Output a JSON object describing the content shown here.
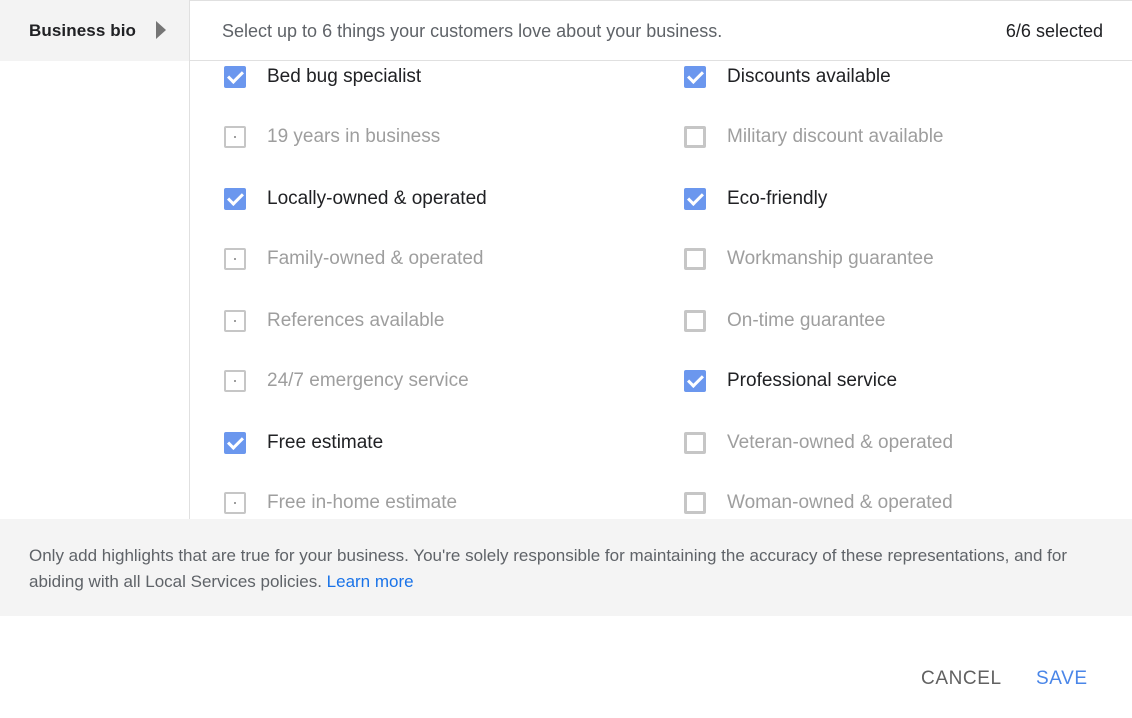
{
  "sidebar": {
    "item_label": "Business bio"
  },
  "header": {
    "instruction": "Select up to 6 things your customers love about your business.",
    "count": "6/6 selected"
  },
  "options": [
    {
      "label": "Bed bug specialist",
      "checked": true,
      "column": "left"
    },
    {
      "label": "Discounts available",
      "checked": true,
      "column": "right"
    },
    {
      "label": "19 years in business",
      "checked": false,
      "column": "left"
    },
    {
      "label": "Military discount available",
      "checked": false,
      "column": "right"
    },
    {
      "label": "Locally-owned & operated",
      "checked": true,
      "column": "left"
    },
    {
      "label": "Eco-friendly",
      "checked": true,
      "column": "right"
    },
    {
      "label": "Family-owned & operated",
      "checked": false,
      "column": "left"
    },
    {
      "label": "Workmanship guarantee",
      "checked": false,
      "column": "right"
    },
    {
      "label": "References available",
      "checked": false,
      "column": "left"
    },
    {
      "label": "On-time guarantee",
      "checked": false,
      "column": "right"
    },
    {
      "label": "24/7 emergency service",
      "checked": false,
      "column": "left"
    },
    {
      "label": "Professional service",
      "checked": true,
      "column": "right"
    },
    {
      "label": "Free estimate",
      "checked": true,
      "column": "left"
    },
    {
      "label": "Veteran-owned & operated",
      "checked": false,
      "column": "right"
    },
    {
      "label": "Free in-home estimate",
      "checked": false,
      "column": "left"
    },
    {
      "label": "Woman-owned & operated",
      "checked": false,
      "column": "right"
    }
  ],
  "disclaimer": {
    "text": "Only add highlights that are true for your business. You're solely responsible for maintaining the accuracy of these representations, and for abiding with all Local Services policies. ",
    "link": "Learn more"
  },
  "buttons": {
    "cancel": "CANCEL",
    "save": "SAVE"
  },
  "colors": {
    "accent": "#4a86e8",
    "checkbox": "#6b97ee",
    "link": "#1a73e8"
  }
}
